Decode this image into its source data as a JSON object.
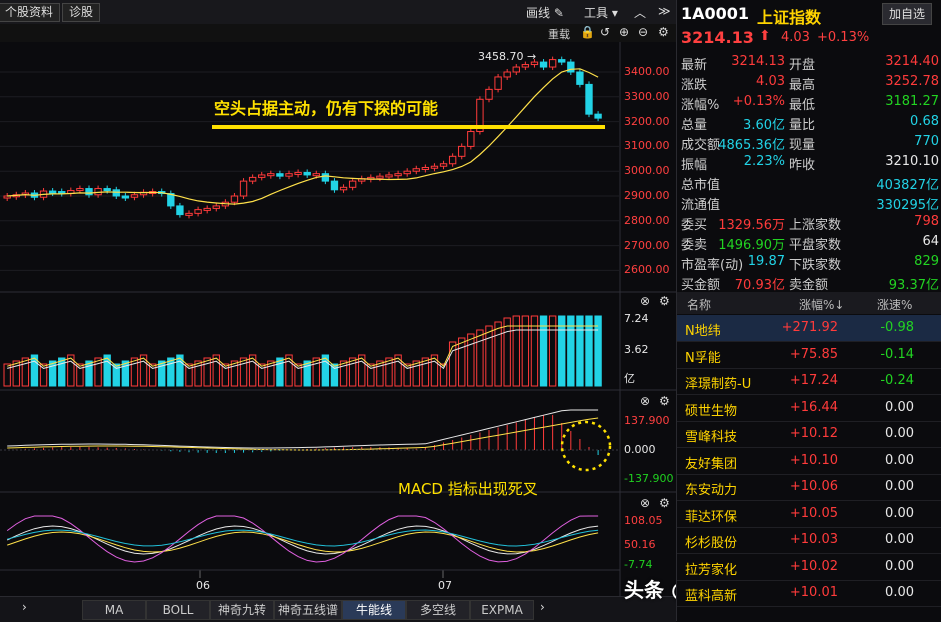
{
  "toolbar": {
    "btn_stock_info": "个股资料",
    "btn_diagnose": "诊股",
    "draw_label": "画线",
    "tools_label": "工具",
    "reload_label": "重载"
  },
  "kline_axis": [
    "3400.00",
    "3300.00",
    "3200.00",
    "3100.00",
    "3000.00",
    "2900.00",
    "2800.00",
    "2700.00",
    "2600.00"
  ],
  "high_marker": "3458.70",
  "annotation_support": "空头占据主动，仍有下探的可能",
  "annotation_macd": "MACD 指标出现死叉",
  "volume_axis": [
    "7.24",
    "3.62",
    "亿"
  ],
  "macd_axis": [
    "137.900",
    "0.000",
    "-137.900"
  ],
  "kdj_axis": [
    "108.05",
    "50.16",
    "-7.74"
  ],
  "x_labels": [
    "06",
    "07"
  ],
  "bottom_tabs": [
    "MA",
    "BOLL",
    "神奇九转",
    "神奇五线谱",
    "牛能线",
    "多空线",
    "EXPMA"
  ],
  "bottom_active": "牛能线",
  "watermark": "头条 @一女一男的理财之路",
  "header": {
    "code": "1A0001",
    "name": "上证指数",
    "add_btn": "加自选",
    "price": "3214.13",
    "change": "4.03",
    "change_pct": "+0.13%"
  },
  "quote": [
    {
      "l1": "最新",
      "v1": "3214.13",
      "c1": "red",
      "l2": "开盘",
      "v2": "3214.40",
      "c2": "red"
    },
    {
      "l1": "涨跌",
      "v1": "4.03",
      "c1": "red",
      "l2": "最高",
      "v2": "3252.78",
      "c2": "red"
    },
    {
      "l1": "涨幅%",
      "v1": "+0.13%",
      "c1": "red",
      "l2": "最低",
      "v2": "3181.27",
      "c2": "green"
    },
    {
      "l1": "总量",
      "v1": "3.60亿",
      "c1": "cyan",
      "l2": "量比",
      "v2": "0.68",
      "c2": "cyan"
    },
    {
      "l1": "成交额",
      "v1": "4865.36亿",
      "c1": "cyan",
      "l2": "现量",
      "v2": "770",
      "c2": "cyan"
    },
    {
      "l1": "振幅",
      "v1": "2.23%",
      "c1": "cyan",
      "l2": "昨收",
      "v2": "3210.10",
      "c2": "white"
    },
    {
      "l1": "总市值",
      "v1": "",
      "c1": "cyan",
      "l2": "",
      "v2": "403827亿",
      "c2": "cyan"
    },
    {
      "l1": "流通值",
      "v1": "",
      "c1": "cyan",
      "l2": "",
      "v2": "330295亿",
      "c2": "cyan"
    },
    {
      "l1": "委买",
      "v1": "1329.56万",
      "c1": "red",
      "l2": "上涨家数",
      "v2": "798",
      "c2": "red"
    },
    {
      "l1": "委卖",
      "v1": "1496.90万",
      "c1": "green",
      "l2": "平盘家数",
      "v2": "64",
      "c2": "white"
    },
    {
      "l1": "市盈率(动)",
      "v1": "19.87",
      "c1": "cyan",
      "l2": "下跌家数",
      "v2": "829",
      "c2": "green"
    },
    {
      "l1": "买金额",
      "v1": "70.93亿",
      "c1": "red",
      "l2": "卖金额",
      "v2": "93.37亿",
      "c2": "green"
    }
  ],
  "table": {
    "h_name": "名称",
    "h_pct": "涨幅%↓",
    "h_speed": "涨速%",
    "rows": [
      {
        "name": "N地纬",
        "pct": "+271.92",
        "speed": "-0.98",
        "sc": "green"
      },
      {
        "name": "N孚能",
        "pct": "+75.85",
        "speed": "-0.14",
        "sc": "green"
      },
      {
        "name": "泽璟制药-U",
        "pct": "+17.24",
        "speed": "-0.24",
        "sc": "green"
      },
      {
        "name": "硕世生物",
        "pct": "+16.44",
        "speed": "0.00",
        "sc": "white"
      },
      {
        "name": "雪峰科技",
        "pct": "+10.12",
        "speed": "0.00",
        "sc": "white"
      },
      {
        "name": "友好集团",
        "pct": "+10.10",
        "speed": "0.00",
        "sc": "white"
      },
      {
        "name": "东安动力",
        "pct": "+10.06",
        "speed": "0.00",
        "sc": "white"
      },
      {
        "name": "菲达环保",
        "pct": "+10.05",
        "speed": "0.00",
        "sc": "white"
      },
      {
        "name": "杉杉股份",
        "pct": "+10.03",
        "speed": "0.00",
        "sc": "white"
      },
      {
        "name": "拉芳家化",
        "pct": "+10.02",
        "speed": "0.00",
        "sc": "white"
      },
      {
        "name": "蓝科高新",
        "pct": "+10.01",
        "speed": "0.00",
        "sc": "white"
      }
    ]
  },
  "colors": {
    "up": "#ff3b3b",
    "down": "#22d3e6",
    "ma": "#ffe14a",
    "white": "#e8e8e8",
    "accent_yellow": "#ffd400"
  }
}
